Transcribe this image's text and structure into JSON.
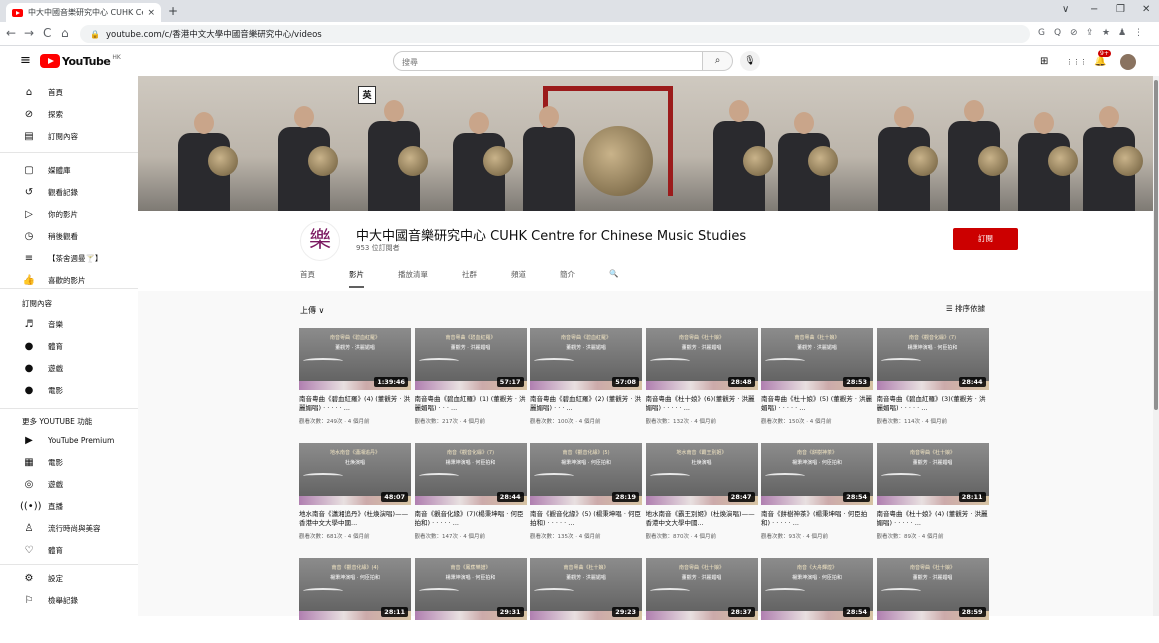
{
  "browser": {
    "tab_title": "中大中國音樂研究中心 CUHK Ce",
    "tab_close": "×",
    "new_tab": "+",
    "url": "youtube.com/c/香港中文大學中國音樂研究中心/videos",
    "nav": {
      "back": "←",
      "forward": "→",
      "reload": "C",
      "home": "⌂"
    },
    "window": {
      "dropdown": "∨",
      "minimize": "−",
      "restore": "❐",
      "close": "✕"
    },
    "extensions": [
      "G",
      "Q",
      "⊘",
      "⇪",
      "★",
      "♟",
      "⋮"
    ]
  },
  "youtube": {
    "logo_text": "YouTube",
    "region": "HK",
    "search_placeholder": "搜尋",
    "search_icon": "search-icon",
    "mic_icon": "mic-icon",
    "notif_count": "9+",
    "header_icons": [
      "⊞",
      "⋮⋮⋮",
      "🔔"
    ]
  },
  "sidebar": {
    "main": [
      {
        "icon": "⌂",
        "label": "首頁"
      },
      {
        "icon": "⊘",
        "label": "探索"
      },
      {
        "icon": "▤",
        "label": "訂閱內容"
      }
    ],
    "library": [
      {
        "icon": "▢",
        "label": "媒體庫"
      },
      {
        "icon": "↺",
        "label": "觀看記錄"
      },
      {
        "icon": "▷",
        "label": "你的影片"
      },
      {
        "icon": "◷",
        "label": "稍後觀看"
      },
      {
        "icon": "≡",
        "label": "【茶舍週曼🍸】"
      },
      {
        "icon": "👍",
        "label": "喜歡的影片"
      }
    ],
    "subscriptions_title": "訂閱內容",
    "subscriptions": [
      {
        "icon": "♬",
        "label": "音樂"
      },
      {
        "icon": "●",
        "label": "體育"
      },
      {
        "icon": "●",
        "label": "遊戲"
      },
      {
        "icon": "●",
        "label": "電影"
      }
    ],
    "more_title": "更多 YOUTUBE 功能",
    "more": [
      {
        "icon": "▶",
        "label": "YouTube Premium"
      },
      {
        "icon": "▦",
        "label": "電影"
      },
      {
        "icon": "◎",
        "label": "遊戲"
      },
      {
        "icon": "((•))",
        "label": "直播"
      },
      {
        "icon": "♙",
        "label": "流行時尚與美容"
      },
      {
        "icon": "♡",
        "label": "體育"
      }
    ],
    "bottom": [
      {
        "icon": "⚙",
        "label": "設定"
      },
      {
        "icon": "⚐",
        "label": "檢舉記錄"
      }
    ]
  },
  "channel": {
    "banner_badge": "英",
    "logo_char": "樂",
    "name": "中大中國音樂研究中心 CUHK Centre for Chinese Music Studies",
    "subscribers": "953 位訂閱者",
    "subscribe_label": "訂閱",
    "tabs": [
      "首頁",
      "影片",
      "播放清單",
      "社群",
      "頻道",
      "簡介"
    ],
    "active_tab": "影片",
    "search_icon": "🔍"
  },
  "videos_section": {
    "sort_left": "上傳 ∨",
    "sort_right": "排序依據",
    "sort_icon": "☰",
    "rows": [
      [
        {
          "t1": "南音粵曲《碧血紅羅》",
          "t2": "董觀芳 · 洪麗媚唱",
          "dur": "1:39:46",
          "title": "南音粵曲《碧血紅羅》(4) (董觀芳 · 洪麗媚唱) · · · · · ...",
          "meta": "觀看次數：249次 · 4 個月前"
        },
        {
          "t1": "南音粵曲《碧血紅羅》",
          "t2": "董觀芳 · 洪麗媚唱",
          "dur": "57:17",
          "title": "南音粵曲《碧血紅羅》(1) (董觀芳 · 洪麗媚唱) · · · ...",
          "meta": "觀看次數：217次 · 4 個月前"
        },
        {
          "t1": "南音粵曲《碧血紅羅》",
          "t2": "董觀芳 · 洪麗媚唱",
          "dur": "57:08",
          "title": "南音粵曲《碧血紅羅》(2) (董觀芳 · 洪麗媚唱) · · · ...",
          "meta": "觀看次數：100次 · 4 個月前"
        },
        {
          "t1": "南音粵曲《杜十娘》",
          "t2": "董觀芳 · 洪麗媚唱",
          "dur": "28:48",
          "title": "南音粵曲《杜十娘》(6)(董觀芳 · 洪麗媚唱) · · · · · ...",
          "meta": "觀看次數：132次 · 4 個月前"
        },
        {
          "t1": "南音粵曲《杜十娘》",
          "t2": "董觀芳 · 洪麗媚唱",
          "dur": "28:53",
          "title": "南音粵曲《杜十娘》(5) (董觀芳 · 洪麗媚唱) · · · · · ...",
          "meta": "觀看次數：150次 · 4 個月前"
        },
        {
          "t1": "南音《觀音化緣》(7)",
          "t2": "楊秉坤演唱 · 何臣拍和",
          "dur": "28:44",
          "title": "南音粵曲《碧血紅羅》(3)(董觀芳 · 洪麗媚唱) · · · · · ...",
          "meta": "觀看次數：114次 · 4 個月前"
        }
      ],
      [
        {
          "t1": "地水南音《瀟湘追丹》",
          "t2": "杜煥演唱",
          "dur": "48:07",
          "title": "地水南音《瀟湘追丹》(杜煥演唱)——香港中文大學中國...",
          "meta": "觀看次數：681次 · 4 個月前"
        },
        {
          "t1": "南音《觀音化緣》(7)",
          "t2": "楊秉坤演唱 · 何臣拍和",
          "dur": "28:44",
          "title": "南音《觀音化緣》(7)(楊秉坤唱 · 何臣拍和) · · · · · ...",
          "meta": "觀看次數：147次 · 4 個月前"
        },
        {
          "t1": "南音《觀音化緣》(5)",
          "t2": "楊秉坤演唱 · 何臣拍和",
          "dur": "28:19",
          "title": "南音《觀音化緣》(5) (楊秉坤唱 · 何臣拍和) · · · · · ...",
          "meta": "觀看次數：135次 · 4 個月前"
        },
        {
          "t1": "地水南音《霸王別姬》",
          "t2": "杜煥演唱",
          "dur": "28:47",
          "title": "地水南音《霸王別姬》(杜煥演唱)——香港中文大學中國...",
          "meta": "觀看次數：870次 · 4 個月前"
        },
        {
          "t1": "南音《餅樹神茶》",
          "t2": "楊秉坤演唱 · 何臣拍和",
          "dur": "28:54",
          "title": "南音《餅樹神茶》(楊秉坤唱 · 何臣拍和) · · · · · ...",
          "meta": "觀看次數：93次 · 4 個月前"
        },
        {
          "t1": "南音粵曲《杜十娘》",
          "t2": "董觀芳 · 洪麗媚唱",
          "dur": "28:11",
          "title": "南音粵曲《杜十娘》(4) (董觀芳 · 洪麗媚唱) · · · · · ...",
          "meta": "觀看次數：89次 · 4 個月前"
        }
      ],
      [
        {
          "t1": "南音《觀音化緣》(4)",
          "t2": "楊秉坤演唱 · 何臣拍和",
          "dur": "28:11",
          "title": "",
          "meta": ""
        },
        {
          "t1": "南音《鳳蕉樂譜》",
          "t2": "楊秉坤演唱 · 何臣拍和",
          "dur": "29:31",
          "title": "",
          "meta": ""
        },
        {
          "t1": "南音粵曲《杜十娘》",
          "t2": "董觀芳 · 洪麗媚唱",
          "dur": "29:23",
          "title": "",
          "meta": ""
        },
        {
          "t1": "南音粵曲《杜十娘》",
          "t2": "董觀芳 · 洪麗媚唱",
          "dur": "28:37",
          "title": "",
          "meta": ""
        },
        {
          "t1": "南音《大舟輝煌》",
          "t2": "楊秉坤演唱 · 何臣拍和",
          "dur": "28:54",
          "title": "",
          "meta": ""
        },
        {
          "t1": "南音粵曲《杜十娘》",
          "t2": "董觀芳 · 洪麗媚唱",
          "dur": "28:59",
          "title": "",
          "meta": ""
        }
      ]
    ]
  }
}
